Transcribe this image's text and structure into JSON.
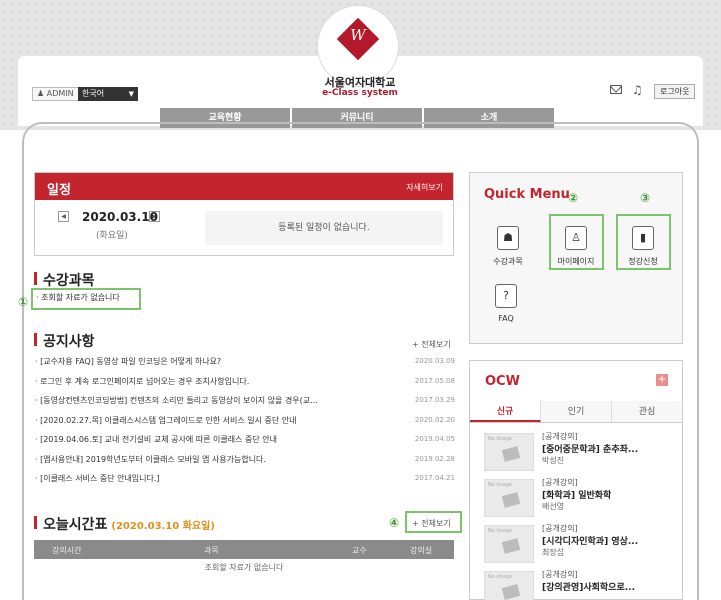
{
  "header": {
    "university_name": "서울여자대학교",
    "system_name": "e-Class system",
    "admin_label": "ADMIN",
    "language": "한국어",
    "logout_label": "로그아웃"
  },
  "nav": {
    "items": [
      "교육현황",
      "커뮤니티",
      "소개"
    ]
  },
  "schedule": {
    "title": "일정",
    "more_label": "자세히보기",
    "date": "2020.03.10",
    "day": "(화요일)",
    "empty_message": "등록된 일정이 없습니다."
  },
  "courses": {
    "title": "수강과목",
    "empty_message": "조회할 자료가 없습니다"
  },
  "notices": {
    "title": "공지사항",
    "more_label": "+ 전체보기",
    "items": [
      {
        "title": "[교수자용 FAQ] 동영상 파일 인코딩은 어떻게 하나요?",
        "date": "2020.03.09"
      },
      {
        "title": "로그인 후 계속 로그인페이지로 넘어오는 경우 조치사항입니다.",
        "date": "2017.05.08"
      },
      {
        "title": "[동영상컨텐츠인코딩방법] 컨텐츠의 소리만 들리고 동영상이 보이지 않을 경우(교...",
        "date": "2017.03.29"
      },
      {
        "title": "[2020.02.27.목] 이클래스시스템 업그레이드로 인한 서비스 일시 중단 안내",
        "date": "2020.02.20"
      },
      {
        "title": "[2019.04.06.토] 교내 전기설비 교체 공사에 따른 이클래스 중단 안내",
        "date": "2019.04.05"
      },
      {
        "title": "[앱사용안내] 2019학년도부터 이클래스 모바일 앱 사용가능합니다.",
        "date": "2019.02.28"
      },
      {
        "title": "[이클래스 서비스 중단 안내입니다.]",
        "date": "2017.04.21"
      }
    ]
  },
  "timetable": {
    "title": "오늘시간표",
    "date_label": "(2020.03.10 화요일)",
    "more_label": "+ 전체보기",
    "columns": [
      "강의시간",
      "과목",
      "교수",
      "강의실"
    ],
    "empty_message": "조회할 자료가 없습니다"
  },
  "quick_menu": {
    "title": "Quick Menu",
    "items": [
      {
        "label": "수강과목",
        "icon": "course-icon"
      },
      {
        "label": "마이페이지",
        "icon": "mypage-icon"
      },
      {
        "label": "정강신청",
        "icon": "book-icon"
      },
      {
        "label": "FAQ",
        "icon": "faq-icon"
      }
    ]
  },
  "ocw": {
    "title": "OCW",
    "tabs": [
      "신규",
      "인기",
      "관심"
    ],
    "thumb_label": "No image",
    "items": [
      {
        "category": "[공개강의]",
        "name": "[중어중문학과] 춘추좌...",
        "professor": "박성진"
      },
      {
        "category": "[공개강의]",
        "name": "[화학과] 일반화학",
        "professor": "배선영"
      },
      {
        "category": "[공개강의]",
        "name": "[시각디자인학과] 영상...",
        "professor": "최장섭"
      },
      {
        "category": "[공개강의]",
        "name": "[강의관영]사회학으로...",
        "professor": ""
      }
    ]
  },
  "annotations": [
    "①",
    "②",
    "③",
    "④"
  ],
  "colors": {
    "brand": "#c4242e",
    "highlight": "#7dc36b",
    "nav": "#999999"
  }
}
